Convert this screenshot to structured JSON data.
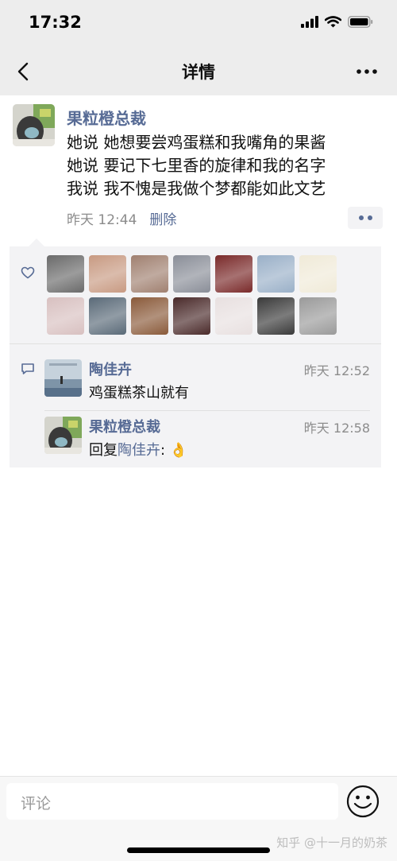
{
  "status_bar": {
    "time": "17:32"
  },
  "nav": {
    "title": "详情"
  },
  "post": {
    "author": "果粒橙总裁",
    "lines": [
      "她说 她想要尝鸡蛋糕和我嘴角的果酱",
      "她说 要记下七里香的旋律和我的名字",
      "我说 我不愧是我做个梦都能如此文艺"
    ],
    "time": "昨天 12:44",
    "delete_label": "删除"
  },
  "likes": {
    "avatar_colors": [
      "#6a6a6a",
      "#c89a82",
      "#a08070",
      "#8a8e98",
      "#7a2a2a",
      "#9ab0c8",
      "#f0ead8",
      "#d8c0c0",
      "#5a6a78",
      "#8a5a3a",
      "#4a2a2a",
      "#e8e0e0",
      "#3a3a3a",
      "#9a9a9a"
    ]
  },
  "comments": [
    {
      "name": "陶佳卉",
      "time": "昨天 12:52",
      "text": "鸡蛋糕茶山就有"
    },
    {
      "name": "果粒橙总裁",
      "time": "昨天 12:58",
      "prefix": "回复",
      "reply_to": "陶佳卉",
      "suffix": ": 👌"
    }
  ],
  "input": {
    "placeholder": "评论"
  },
  "watermark": "知乎 @十一月的奶茶",
  "colors": {
    "link": "#576b95",
    "panel": "#f3f3f5",
    "nav": "#ededed"
  }
}
